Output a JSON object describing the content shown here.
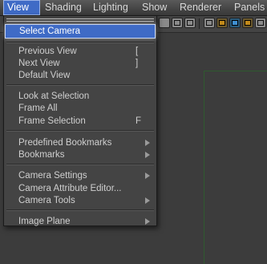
{
  "menubar": {
    "items": [
      "View",
      "Shading",
      "Lighting",
      "Show",
      "Renderer",
      "Panels"
    ]
  },
  "menu": {
    "items": [
      {
        "label": "Select Camera"
      },
      {
        "label": "Previous View",
        "shortcut": "["
      },
      {
        "label": "Next View",
        "shortcut": "]"
      },
      {
        "label": "Default View"
      },
      {
        "label": "Look at Selection"
      },
      {
        "label": "Frame All"
      },
      {
        "label": "Frame Selection",
        "shortcut": "F"
      },
      {
        "label": "Predefined Bookmarks"
      },
      {
        "label": "Bookmarks"
      },
      {
        "label": "Camera Settings"
      },
      {
        "label": "Camera Attribute Editor..."
      },
      {
        "label": "Camera Tools"
      },
      {
        "label": "Image Plane"
      }
    ]
  },
  "colors": {
    "highlight": "#3f6bc6",
    "menu_bg": "#444444",
    "text": "#cfcfcf"
  }
}
